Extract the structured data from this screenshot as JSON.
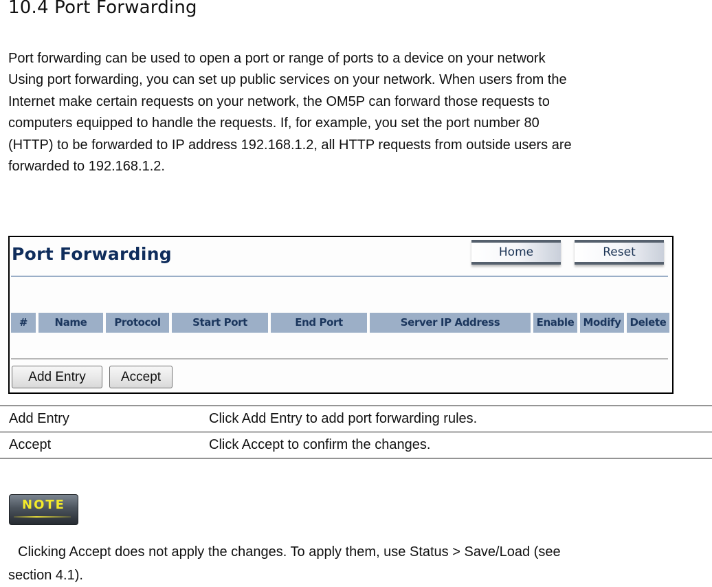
{
  "section": {
    "title": "10.4 Port Forwarding",
    "intro_lines": [
      "Port forwarding can be used to open a port or range of ports to a device on your network",
      "Using port forwarding, you can set up public services on your network. When users from the",
      "Internet make certain requests on your network, the OM5P can forward those requests to",
      "computers equipped to handle the requests. If, for example, you set the port number 80",
      "(HTTP) to be forwarded to IP address 192.168.1.2, all HTTP requests from outside users are",
      "forwarded to 192.168.1.2."
    ]
  },
  "ui": {
    "title": "Port Forwarding",
    "home_label": "Home",
    "reset_label": "Reset",
    "columns": [
      "#",
      "Name",
      "Protocol",
      "Start Port",
      "End Port",
      "Server IP Address",
      "Enable",
      "Modify",
      "Delete"
    ],
    "add_entry_label": "Add Entry",
    "accept_label": "Accept",
    "colors": {
      "title": "#0f2d5c",
      "header_bg": "#9cafc7",
      "header_text": "#1b365d"
    }
  },
  "descriptions": [
    {
      "term": "Add Entry",
      "definition": "Click Add Entry to add port forwarding rules."
    },
    {
      "term": "Accept",
      "definition": "Click Accept to confirm the changes."
    }
  ],
  "note": {
    "badge": "NOTE",
    "lines": [
      "Clicking Accept does not apply the changes. To apply them, use Status > Save/Load (see",
      "section 4.1)."
    ]
  }
}
